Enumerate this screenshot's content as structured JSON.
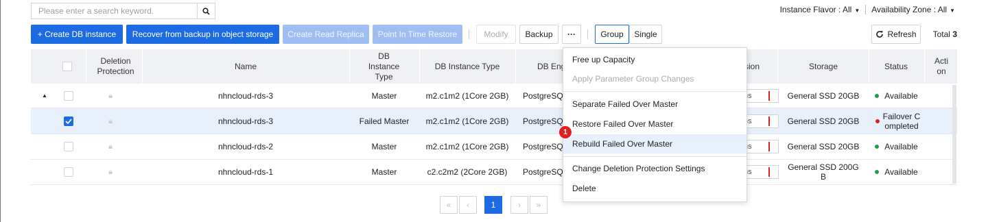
{
  "search": {
    "placeholder": "Please enter a search keyword.",
    "icon": "search-icon"
  },
  "filters": {
    "instance_flavor": "Instance Flavor : All",
    "availability_zone": "Availability Zone : All"
  },
  "toolbar": {
    "create": "+ Create DB instance",
    "recover": "Recover from backup in object storage",
    "create_replica": "Create Read Replica",
    "pitr": "Point In Time Restore",
    "modify": "Modify",
    "backup": "Backup",
    "more": "···",
    "group": "Group",
    "single": "Single",
    "refresh": "Refresh",
    "total_label": "Total",
    "total_value": "3"
  },
  "table": {
    "headers": {
      "deletion": "Deletion Protection",
      "name": "Name",
      "db_instance_type_role": "DB Instance Type",
      "db_instance_type": "DB Instance Type",
      "db_engine": "DB Eng",
      "version": "sion",
      "storage": "Storage",
      "status": "Status",
      "action": "Acti on"
    },
    "rows": [
      {
        "expander": "▲",
        "checked": false,
        "name": "nhncloud-rds-3",
        "role": "Master",
        "type": "m2.c1m2 (1Core 2GB)",
        "engine": "PostgreSQ",
        "version": "ns",
        "storage": "General SSD 20GB",
        "status": "Available",
        "status_color": "#19a04b"
      },
      {
        "expander": "",
        "checked": true,
        "name": "nhncloud-rds-3",
        "role": "Failed Master",
        "type": "m2.c1m2 (1Core 2GB)",
        "engine": "PostgreSQ",
        "version": "ns",
        "storage": "General SSD 20GB",
        "status": "Failover C ompleted",
        "status_color": "#e02020"
      },
      {
        "expander": "",
        "checked": false,
        "name": "nhncloud-rds-2",
        "role": "Master",
        "type": "m2.c1m2 (1Core 2GB)",
        "engine": "PostgreSQ",
        "version": "ns",
        "storage": "General SSD 20GB",
        "status": "Available",
        "status_color": "#19a04b"
      },
      {
        "expander": "",
        "checked": false,
        "name": "nhncloud-rds-1",
        "role": "Master",
        "type": "c2.c2m2 (2Core 2GB)",
        "engine": "PostgreSQ",
        "version": "ns",
        "storage": "General SSD 200G B",
        "status": "Available",
        "status_color": "#19a04b"
      }
    ]
  },
  "menu": {
    "items": [
      "Free up Capacity",
      "Apply Parameter Group Changes",
      "Separate Failed Over Master",
      "Restore Failed Over Master",
      "Rebuild Failed Over Master",
      "Change Deletion Protection Settings",
      "Delete"
    ],
    "badge": "1"
  },
  "pagination": {
    "first": "«",
    "prev": "‹",
    "current": "1",
    "next": "›",
    "last": "»"
  },
  "colors": {
    "accent": "#1d6be3",
    "success": "#19a04b",
    "danger": "#e02020"
  }
}
